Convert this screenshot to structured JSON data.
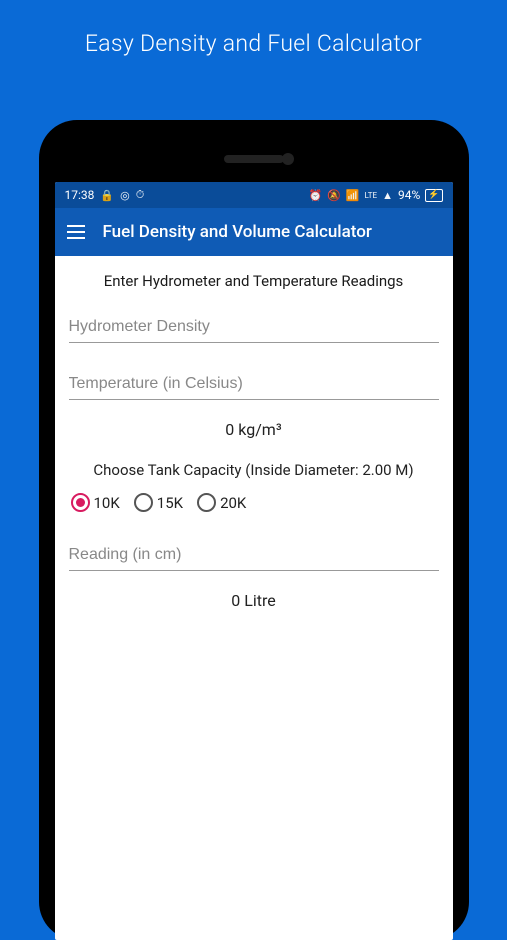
{
  "promo": {
    "title": "Easy Density and Fuel Calculator"
  },
  "statusBar": {
    "time": "17:38",
    "lockIcon": "🔒",
    "targetIcon": "◎",
    "clockIcon": "⏱",
    "alarmIcon": "⏰",
    "muteIcon": "🔕",
    "networkIcon": "📶",
    "lteText": "LTE",
    "signalIcon": "▲",
    "batteryPct": "94%",
    "batteryIcon": "⚡"
  },
  "appBar": {
    "title": "Fuel Density and Volume Calculator"
  },
  "form": {
    "header": "Enter Hydrometer and Temperature Readings",
    "hydrometerPlaceholder": "Hydrometer Density",
    "temperaturePlaceholder": "Temperature (in Celsius)",
    "densityResult": "0 kg/m³",
    "tankLabel": "Choose Tank Capacity (Inside Diameter: 2.00 M)",
    "radioOptions": [
      {
        "label": "10K",
        "selected": true
      },
      {
        "label": "15K",
        "selected": false
      },
      {
        "label": "20K",
        "selected": false
      }
    ],
    "readingPlaceholder": "Reading (in cm)",
    "volumeResult": "0 Litre"
  }
}
